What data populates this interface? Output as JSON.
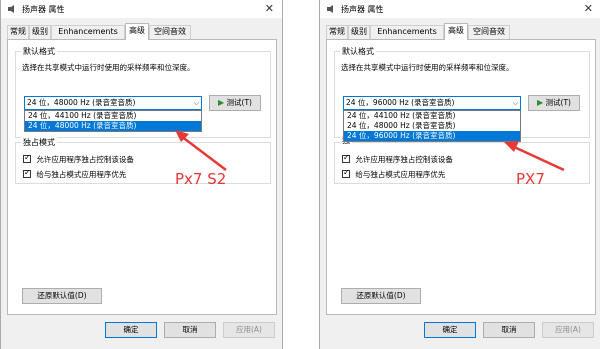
{
  "colors": {
    "accent": "#0078d7",
    "annotation": "#e53935",
    "window_bg": "#f0f0f0"
  },
  "icons": {
    "speaker": "speaker-icon",
    "close": "close-icon",
    "play": "play-icon"
  },
  "left": {
    "title": "扬声器 属性",
    "tabs": [
      "常规",
      "级别",
      "Enhancements",
      "高级",
      "空间音效"
    ],
    "format_group": "默认格式",
    "format_desc": "选择在共享模式中运行时使用的采样频率和位深度。",
    "combo_value": "24 位，48000 Hz (录音室音质)",
    "dropdown": [
      "24 位，44100 Hz (录音室音质)",
      "24 位，48000 Hz (录音室音质)"
    ],
    "test_button": "测试(T)",
    "exclusive_group": "独占模式",
    "check1": "允许应用程序独占控制该设备",
    "check2": "给与独占模式应用程序优先",
    "restore_button": "还原默认值(D)",
    "ok_button": "确定",
    "cancel_button": "取消",
    "apply_button": "应用(A)",
    "annotation": "Px7 S2"
  },
  "right": {
    "title": "扬声器 属性",
    "tabs": [
      "常规",
      "级别",
      "Enhancements",
      "高级",
      "空间音效"
    ],
    "format_group": "默认格式",
    "format_desc": "选择在共享模式中运行时使用的采样频率和位深度。",
    "combo_value": "24 位，96000 Hz (录音室音质)",
    "dropdown": [
      "24 位，44100 Hz (录音室音质)",
      "24 位，48000 Hz (录音室音质)",
      "24 位，96000 Hz (录音室音质)"
    ],
    "test_button": "测试(T)",
    "exclusive_group": "独",
    "check1": "允许应用程序独占控制该设备",
    "check2": "给与独占模式应用程序优先",
    "restore_button": "还原默认值(D)",
    "ok_button": "确定",
    "cancel_button": "取消",
    "apply_button": "应用(A)",
    "annotation": "PX7"
  }
}
